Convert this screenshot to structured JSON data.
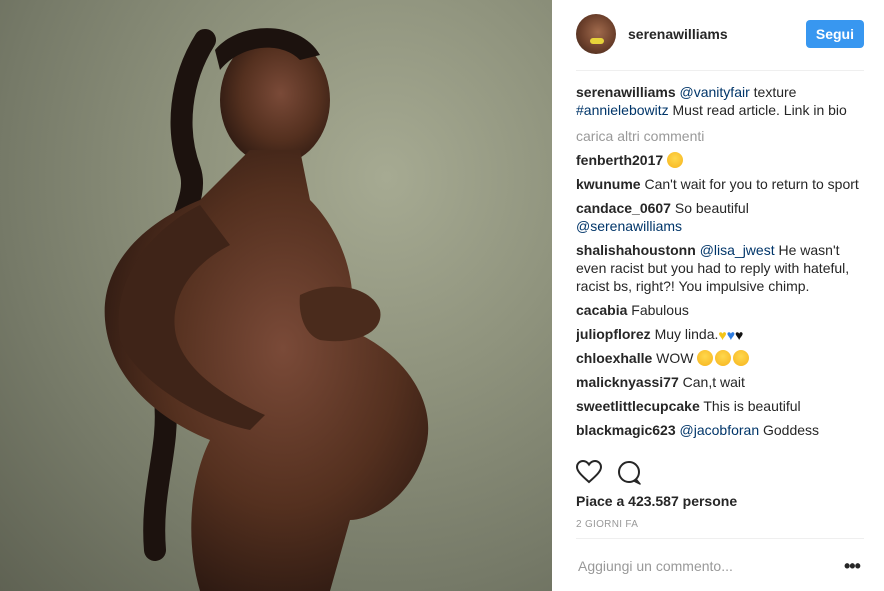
{
  "post": {
    "username": "serenawilliams",
    "follow_label": "Segui"
  },
  "caption": {
    "user": "serenawilliams",
    "mention": "@vanityfair",
    "text1": " texture ",
    "hashtag": "#annielebowitz",
    "text2": " Must read article. Link in bio"
  },
  "load_more": "carica altri commenti",
  "comments": [
    {
      "user": "fenberth2017",
      "text": "",
      "emoji": "tongue-emoji"
    },
    {
      "user": "kwunume",
      "text": "Can't wait for you to return to sport"
    },
    {
      "user": "candace_0607",
      "text": "So beautiful",
      "mention": "@serenawilliams"
    },
    {
      "user": "shalishahoustonn",
      "mention": "@lisa_jwest",
      "text": "He wasn't even racist but you had to reply with hateful, racist bs, right?! You impulsive chimp."
    },
    {
      "user": "cacabia",
      "text": "Fabulous"
    },
    {
      "user": "juliopflorez",
      "text": "Muy linda.",
      "emoji": "hearts-emoji"
    },
    {
      "user": "chloexhalle",
      "text": "WOW",
      "emoji": "heart-eyes-emoji"
    },
    {
      "user": "malicknyassi77",
      "text": "Can,t wait"
    },
    {
      "user": "sweetlittlecupcake",
      "text": "This is beautiful"
    },
    {
      "user": "blackmagic623",
      "mention": "@jacobforan",
      "text": "Goddess"
    }
  ],
  "likes": "Piace a 423.587 persone",
  "time_ago": "2 GIORNI FA",
  "add_comment_placeholder": "Aggiungi un commento...",
  "colors": {
    "accent": "#3897f0",
    "link": "#003569",
    "muted": "#999999"
  }
}
